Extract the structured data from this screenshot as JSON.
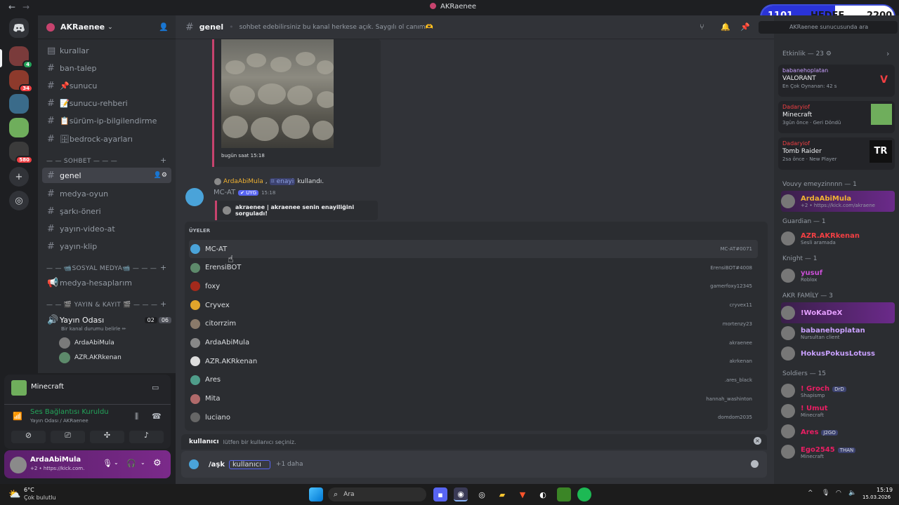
{
  "window": {
    "title": "AKRaenee"
  },
  "goal": {
    "current": "1101",
    "label": "HEDEF",
    "target": "2200"
  },
  "server": {
    "name": "AKRaenee"
  },
  "channels": [
    {
      "label": "kurallar",
      "icon": "rules"
    },
    {
      "label": "ban-talep",
      "icon": "hash"
    },
    {
      "label": "📌sunucu",
      "icon": "hash"
    },
    {
      "label": "📝sunucu-rehberi",
      "icon": "hash"
    },
    {
      "label": "📋sürüm-ip-bilgilendirme",
      "icon": "hash"
    },
    {
      "label": "🗄bedrock-ayarları",
      "icon": "hash"
    }
  ],
  "cat_sohbet": "SOHBET",
  "channels2": [
    "genel",
    "medya-oyun",
    "şarkı-öneri",
    "yayın-video-at",
    "yayın-klip"
  ],
  "cat_sosyal": "SOSYAL MEDYA",
  "medya_hesaplari": "medya-hesaplarım",
  "cat_yayin": "YAYIN & KAYIT",
  "voice": {
    "name": "Yayın Odası",
    "sub": "Bir kanal durumu belirle",
    "count1": "02",
    "count2": "06",
    "users": [
      "ArdaAbiMula",
      "AZR.AKRkenan"
    ]
  },
  "activity_panel": {
    "game": "Minecraft"
  },
  "voice_status": {
    "title": "Ses Bağlantısı Kuruldu",
    "sub": "Yayın Odası / AKRaenee"
  },
  "user_panel": {
    "name": "ArdaAbiMula",
    "sub": "+2 • https://kick.com."
  },
  "header": {
    "channel": "genel",
    "topic": "sohbet edebilirsiniz bu kanal herkese açık. Saygılı ol canım🫶",
    "search": "AKRaenee sunucusunda ara"
  },
  "messages": {
    "image_time": "bugün saat 15:18",
    "reply_user": "ArdaAbiMula",
    "reply_cmd": "enayi",
    "reply_used": "kullandı.",
    "author": "MC-AT",
    "app_tag": "UYG",
    "time": "15:18",
    "embed": "akraenee | akraenee senin enayiliğini sorguladı!"
  },
  "popup": {
    "header": "ÜYELER",
    "users": [
      {
        "name": "MC-AT",
        "tag": "MC-AT#0071"
      },
      {
        "name": "ErensiBOT",
        "tag": "ErensiBOT#4008"
      },
      {
        "name": "foxy",
        "tag": "gamerfoxy12345"
      },
      {
        "name": "Cryvex",
        "tag": "cryvex11"
      },
      {
        "name": "citorrzim",
        "tag": "mortenzy23"
      },
      {
        "name": "ArdaAbiMula",
        "tag": "akraenee"
      },
      {
        "name": "AZR.AKRkenan",
        "tag": "akrkenan"
      },
      {
        "name": "Ares",
        "tag": ".ares_black"
      },
      {
        "name": "Mita",
        "tag": "hannah_washinton"
      },
      {
        "name": "luciano",
        "tag": "domdom2035"
      }
    ]
  },
  "option_hint": {
    "label": "kullanıcı",
    "text": "lütfen bir kullanıcı seçiniz."
  },
  "composer": {
    "command": "/aşk",
    "param": "kullanıcı",
    "more": "+1 daha"
  },
  "activity": {
    "header": "Etkinlik — 23",
    "cards": [
      {
        "user": "babanehoplatan",
        "game": "VALORANT",
        "meta": "En Çok Oynanan: 42 s"
      },
      {
        "user": "Dadaryiof",
        "game": "Minecraft",
        "meta": "3gün önce",
        "extra": "Geri Döndü"
      },
      {
        "user": "Dadaryiof",
        "game": "Tomb Raider",
        "meta": "2sa önce",
        "extra": "New Player"
      }
    ]
  },
  "member_groups": [
    {
      "title": "Vouvy emeyzinnnn — 1",
      "members": [
        {
          "name": "ArdaAbiMula",
          "sub": "+2 • https://kick.com/akraene",
          "color": "#f0b232"
        }
      ]
    },
    {
      "title": "Guardian — 1",
      "members": [
        {
          "name": "AZR.AKRkenan",
          "sub": "Sesli aramada",
          "color": "#f23f43"
        }
      ]
    },
    {
      "title": "Knight — 1",
      "members": [
        {
          "name": "yusuf",
          "sub": "Roblox",
          "color": "#c94fd6"
        }
      ]
    },
    {
      "title": "AKR FAMİLY — 3",
      "members": [
        {
          "name": "!WoKaDeX",
          "sub": "",
          "color": "#e5a0ff"
        },
        {
          "name": "babanehoplatan",
          "sub": "Nursultan client",
          "color": "#c9a0ff"
        },
        {
          "name": "HokusPokusLotuss",
          "sub": "",
          "color": "#c9a0ff"
        }
      ]
    },
    {
      "title": "Soldiers — 15",
      "members": [
        {
          "name": "! Groch",
          "sub": "Shapismp",
          "color": "#e91e63",
          "tag": "DrD"
        },
        {
          "name": "! Umut",
          "sub": "Minecraft",
          "color": "#e91e63"
        },
        {
          "name": "Ares",
          "sub": "",
          "color": "#e91e63",
          "tag": "J2GO"
        },
        {
          "name": "Ego2545",
          "sub": "Minecraft",
          "color": "#e91e63",
          "tag": "THAN"
        }
      ]
    }
  ],
  "taskbar": {
    "weather_temp": "6°C",
    "weather_desc": "Çok bulutlu",
    "search": "Ara",
    "time": "15:19",
    "date": "15.03.2026"
  }
}
